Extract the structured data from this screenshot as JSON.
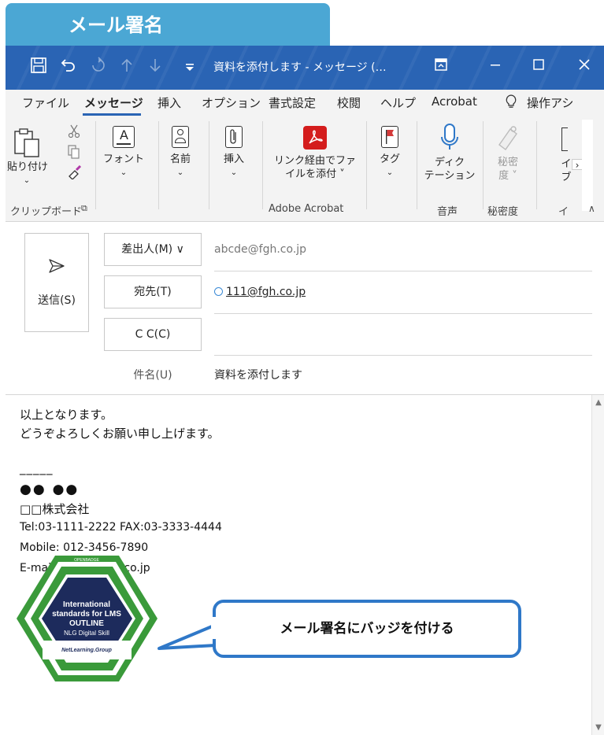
{
  "banner": {
    "title": "メール署名"
  },
  "titlebar": {
    "icons": [
      "save-icon",
      "undo-icon",
      "redo-icon",
      "up-arrow-icon",
      "down-arrow-icon",
      "customize-icon"
    ],
    "title": "資料を添付します  -  メッセージ (…",
    "window_icons": [
      "restore-layout-icon",
      "minimize-icon",
      "maximize-icon",
      "close-icon"
    ]
  },
  "menu": {
    "items": [
      "ファイル",
      "メッセージ",
      "挿入",
      "オプション",
      "書式設定",
      "校閲",
      "ヘルプ",
      "Acrobat",
      "操作アシ"
    ],
    "active": "メッセージ"
  },
  "ribbon": {
    "paste": "貼り付け",
    "font": "フォント",
    "name": "名前",
    "insert": "挿入",
    "acrobat_line1": "リンク経由でファ",
    "acrobat_line2": "イルを添付 ˅",
    "tag": "タグ",
    "dictate_line1": "ディク",
    "dictate_line2": "テーション",
    "sensitivity_line1": "秘密",
    "sensitivity_line2": "度 ˅",
    "more_line1": "イ",
    "more_line2": "ブ",
    "groups": {
      "clipboard": "クリップボード",
      "acrobat": "Adobe Acrobat",
      "voice": "音声",
      "sensitivity": "秘密度",
      "more": "イ"
    }
  },
  "compose": {
    "send": "送信(S)",
    "from_button": "差出人(M) ∨",
    "from_value": "abcde@fgh.co.jp",
    "to_button": "宛先(T)",
    "to_value": "111@fgh.co.jp",
    "cc_button": "C C(C)",
    "subject_label": "件名(U)",
    "subject_value": "資料を添付します"
  },
  "body": {
    "line1": "以上となります。",
    "line2": "どうぞよろしくお願い申し上げます。",
    "separator": "_____",
    "sig_name": "●● ●●",
    "sig_company": "□□株式会社",
    "sig_tel": "Tel:03-1111-2222 FAX:03-3333-4444",
    "sig_mobile": "Mobile: 012-3456-7890",
    "sig_email": "E-mail:abcde@fgh.co.jp"
  },
  "badge": {
    "ring_text": "OPENBADGE",
    "line1": "International",
    "line2": "standards for LMS",
    "line3": "OUTLINE",
    "line4": "NLG Digital Skill",
    "footer": "NetLearning.Group"
  },
  "callout": {
    "text": "メール署名にバッジを付ける"
  },
  "colors": {
    "banner": "#4ba7d4",
    "titlebar": "#2a64b4",
    "callout_border": "#2f78c8",
    "badge_green": "#3a9a3a",
    "badge_navy": "#1d2b5c"
  }
}
